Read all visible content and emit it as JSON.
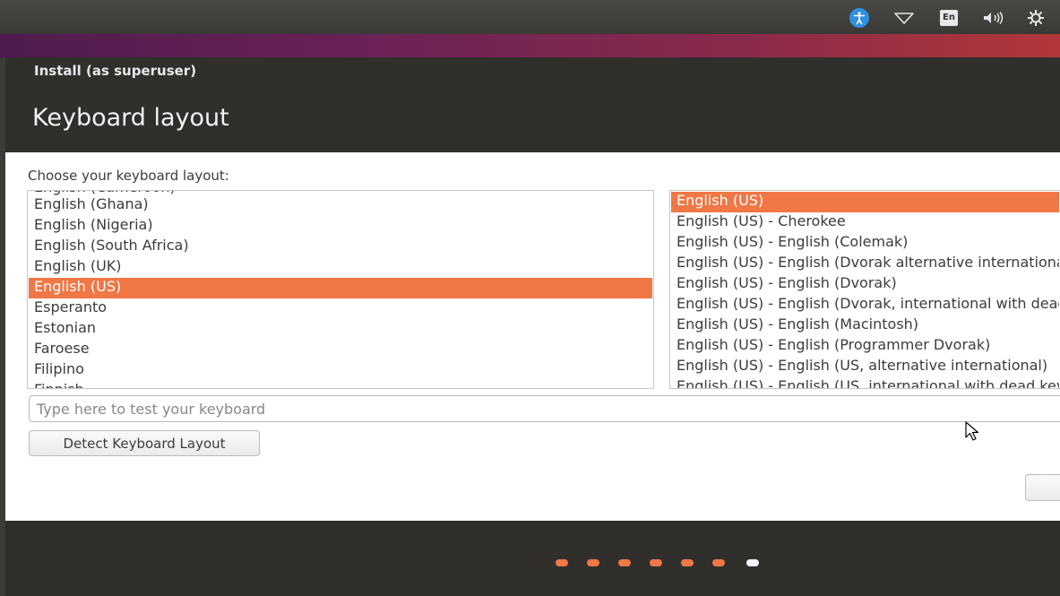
{
  "system_tray": {
    "icons": [
      "accessibility-icon",
      "wifi-icon",
      "keyboard-layout-indicator",
      "volume-icon",
      "settings-icon"
    ],
    "keyboard_indicator": "En",
    "accent_color": "#2f8fe0"
  },
  "window": {
    "title": "Install (as superuser)",
    "page_title": "Keyboard layout"
  },
  "main": {
    "choose_label": "Choose your keyboard layout:",
    "layouts": [
      "English (Ghana)",
      "English (Nigeria)",
      "English (South Africa)",
      "English (UK)",
      "English (US)",
      "Esperanto",
      "Estonian",
      "Faroese",
      "Filipino"
    ],
    "selected_layout": "English (US)",
    "variants": [
      "English (US)",
      "English (US) - Cherokee",
      "English (US) - English (Colemak)",
      "English (US) - English (Dvorak alternative international no dead keys)",
      "English (US) - English (Dvorak)",
      "English (US) - English (Dvorak, international with dead keys)",
      "English (US) - English (Macintosh)",
      "English (US) - English (Programmer Dvorak)",
      "English (US) - English (US, alternative international)"
    ],
    "selected_variant": "English (US)",
    "test_input": {
      "placeholder": "Type here to test your keyboard",
      "value": ""
    },
    "detect_button": "Detect Keyboard Layout"
  },
  "footer": {
    "progress_steps_total": 7,
    "progress_current_step": 7
  },
  "colors": {
    "selection": "#f07746",
    "header_bg": "#302f2c"
  }
}
